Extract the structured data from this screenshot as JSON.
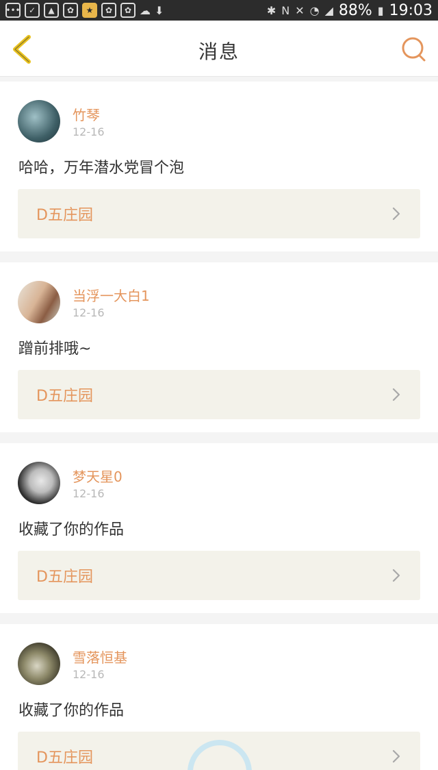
{
  "status_bar": {
    "battery": "88%",
    "time": "19:03"
  },
  "nav": {
    "title": "消息"
  },
  "messages": [
    {
      "username": "竹琴",
      "date": "12-16",
      "content": "哈哈，万年潜水党冒个泡",
      "work_title": "D五庄园",
      "avatar_color": "#4a6d72"
    },
    {
      "username": "当浮一大白1",
      "date": "12-16",
      "content": "蹭前排哦~",
      "work_title": "D五庄园",
      "avatar_color": "#c9a58d"
    },
    {
      "username": "梦天星0",
      "date": "12-16",
      "content": "收藏了你的作品",
      "work_title": "D五庄园",
      "avatar_color": "#888888"
    },
    {
      "username": "雪落恒基",
      "date": "12-16",
      "content": "收藏了你的作品",
      "work_title": "D五庄园",
      "avatar_color": "#6f6b52"
    }
  ],
  "colors": {
    "accent": "#e4955c",
    "back_arrow": "#e9c21f",
    "work_bar_bg": "#f3f2ea"
  }
}
